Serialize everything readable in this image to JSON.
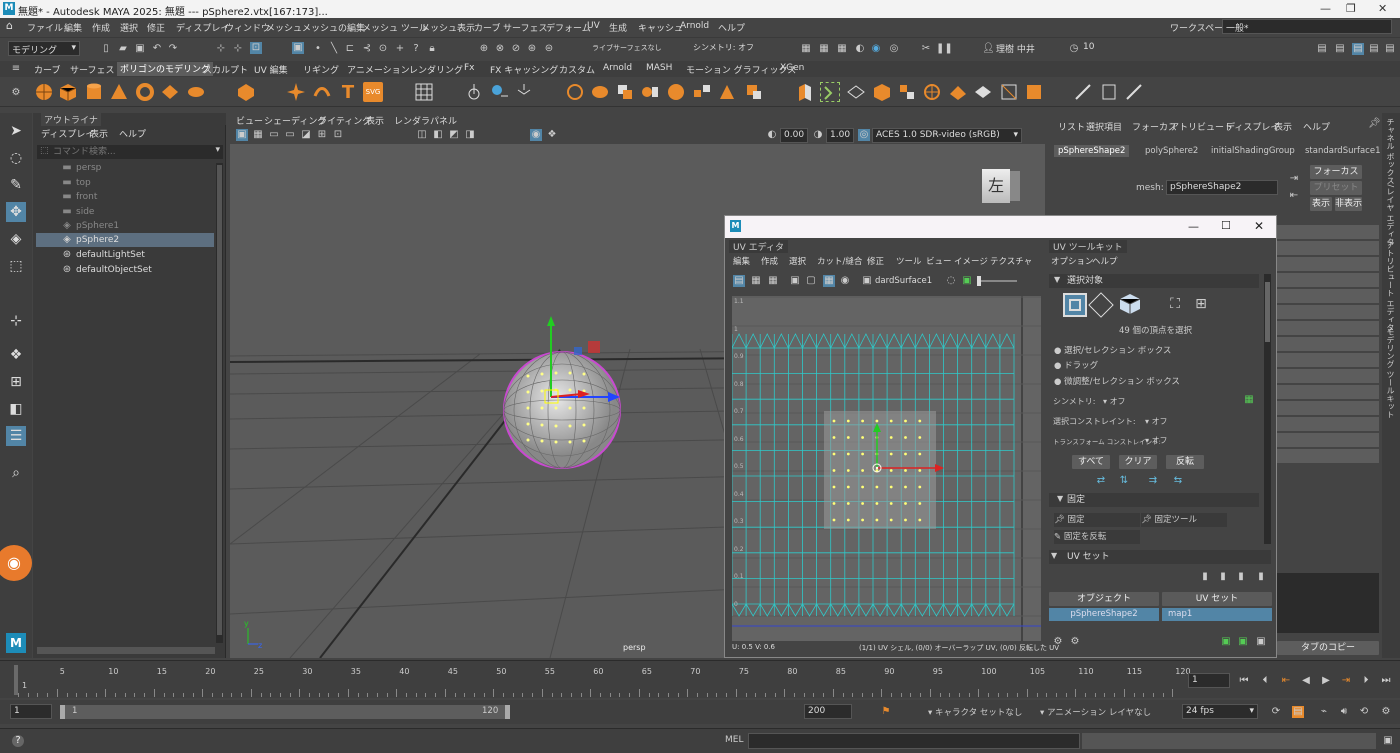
{
  "window": {
    "title": "無題* - Autodesk MAYA 2025: 無題 --- pSphere2.vtx[167:173]...",
    "logo": "M"
  },
  "menubar": {
    "items": [
      "ファイル",
      "編集",
      "作成",
      "選択",
      "修正",
      "ディスプレイ",
      "ウィンドウ",
      "メッシュ",
      "メッシュの編集",
      "メッシュ ツール",
      "メッシュ表示",
      "カーブ",
      "サーフェス",
      "デフォーム",
      "UV",
      "生成",
      "キャッシュ",
      "Arnold",
      "ヘルプ"
    ],
    "workspace_label": "ワークスペース :",
    "workspace_value": "一般*"
  },
  "statusline": {
    "mode": "モデリング",
    "symmetry": "シンメトリ: オフ",
    "live": "ライブ",
    "live_surface": "サーフェスなし",
    "user": "理樹 中井",
    "credits": "10"
  },
  "shelf": {
    "tabs": [
      "カーブ",
      "サーフェス",
      "ポリゴンのモデリング",
      "スカルプト",
      "UV 編集",
      "リギング",
      "アニメーション",
      "レンダリング",
      "Fx",
      "FX キャッシング",
      "カスタム",
      "Arnold",
      "MASH",
      "モーション グラフィックス",
      "XGen"
    ],
    "selected_tab": "ポリゴンのモデリング",
    "svg_label": "SVG",
    "text_label": "T"
  },
  "outliner": {
    "title": "アウトライナ",
    "menu": [
      "ディスプレイ",
      "表示",
      "ヘルプ"
    ],
    "search_placeholder": "コマンド検索...",
    "items": [
      {
        "label": "persp",
        "dim": true
      },
      {
        "label": "top",
        "dim": true
      },
      {
        "label": "front",
        "dim": true
      },
      {
        "label": "side",
        "dim": true
      },
      {
        "label": "pSphere1",
        "dim": true
      },
      {
        "label": "pSphere2",
        "dim": false,
        "selected": true
      },
      {
        "label": "defaultLightSet",
        "dim": false
      },
      {
        "label": "defaultObjectSet",
        "dim": false
      }
    ]
  },
  "viewport": {
    "menu": [
      "ビュー",
      "シェーディング",
      "ライティング",
      "表示",
      "レンダラ",
      "パネル"
    ],
    "exposure": "0.00",
    "gamma": "1.00",
    "colorspace": "ACES 1.0 SDR-video (sRGB)",
    "camera_label": "persp",
    "viewcube_label": "左",
    "axis_y": "y",
    "axis_z": "z"
  },
  "attribute": {
    "menu": [
      "リスト",
      "選択項目",
      "フォーカス",
      "アトリビュート",
      "ディスプレイ",
      "表示",
      "ヘルプ"
    ],
    "tabs": [
      "pSphereShape2",
      "polySphere2",
      "initialShadingGroup",
      "standardSurface1"
    ],
    "mesh_label": "mesh:",
    "mesh_value": "pSphereShape2",
    "focus": "フォーカス",
    "preset": "プリセット",
    "show": "表示",
    "hide": "非表示",
    "copy_tab": "タブのコピー"
  },
  "sidetabs": [
    "チャネル ボックス/レイヤ エディタ",
    "アトリビュート エディタ",
    "モデリング ツールキット"
  ],
  "uv_editor": {
    "title": "UV エディタ",
    "menu": [
      "編集",
      "作成",
      "選択",
      "カット/縫合",
      "修正",
      "ツール",
      "ビュー",
      "イメージ",
      "テクスチャ"
    ],
    "texture": "dardSurface1",
    "status_left": "U: 0.5 V: 0.6",
    "status_right": "(1/1) UV シェル, (0/0) オーバーラップ UV, (0/0) 反転した UV",
    "tick_11": "1.1",
    "tick_1": "1",
    "tick_09": "0.9",
    "tick_08": "0.8",
    "tick_07": "0.7",
    "tick_06": "0.6",
    "tick_05": "0.5",
    "tick_04": "0.4",
    "tick_03": "0.3",
    "tick_02": "0.2",
    "tick_01": "0.1",
    "tick_0": "0"
  },
  "uv_toolkit": {
    "title": "UV ツールキット",
    "menu": [
      "オプション",
      "ヘルプ"
    ],
    "section_select": "選択対象",
    "count": "49 個の頂点を選択",
    "radio": [
      "選択/セレクション ボックス",
      "ドラッグ",
      "微調整/セレクション ボックス"
    ],
    "symmetry_label": "シンメトリ:",
    "symmetry_value": "オフ",
    "sel_constraint_label": "選択コンストレイント:",
    "sel_constraint_value": "オフ",
    "xform_constraint_label": "トランスフォーム コンストレイント:",
    "xform_constraint_value": "オフ",
    "all": "すべて",
    "clear": "クリア",
    "invert": "反転",
    "section_pin": "固定",
    "pin": "固定",
    "pin_tool": "固定ツール",
    "pin_invert": "固定を反転",
    "section_uvset": "UV セット",
    "col_object": "オブジェクト",
    "col_uvset": "UV セット",
    "row_object": "pSphereShape2",
    "row_uvset": "map1"
  },
  "timeline": {
    "ticks": [
      "5",
      "10",
      "15",
      "20",
      "25",
      "30",
      "35",
      "40",
      "45",
      "50",
      "55",
      "60",
      "65",
      "70",
      "75",
      "80",
      "85",
      "90",
      "95",
      "100",
      "105",
      "110",
      "115",
      "120"
    ],
    "current_frame": "1",
    "start_marker": "1"
  },
  "range": {
    "start": "1",
    "inner_start": "1",
    "inner_end": "120",
    "end": "200",
    "character_set": "キャラクタ セットなし",
    "anim_layer": "アニメーション レイヤなし",
    "fps": "24 fps"
  },
  "cmdline": {
    "lang": "MEL"
  },
  "colors": {
    "accent": "#5285a6",
    "orange": "#e88a2c",
    "uv_grid": "#2fc9c9"
  }
}
